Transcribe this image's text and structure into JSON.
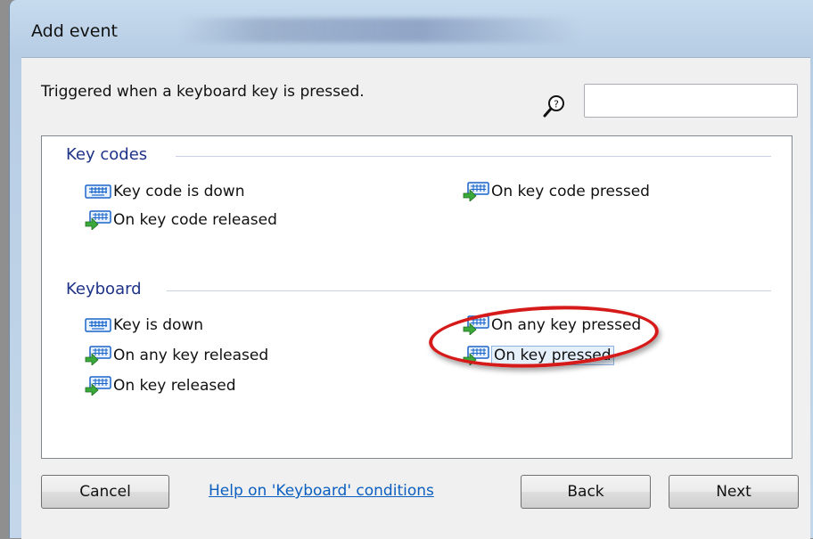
{
  "window": {
    "title": "Add event"
  },
  "description": "Triggered when a keyboard key is pressed.",
  "search": {
    "value": "",
    "icon": "search-help-icon"
  },
  "groups": {
    "key_codes": {
      "header": "Key codes",
      "items": [
        {
          "label": "Key code is down",
          "icon": "keyboard-icon"
        },
        {
          "label": "On key code pressed",
          "icon": "keyboard-arrow-icon"
        },
        {
          "label": "On key code released",
          "icon": "keyboard-arrow-icon"
        }
      ]
    },
    "keyboard": {
      "header": "Keyboard",
      "items": [
        {
          "label": "Key is down",
          "icon": "keyboard-icon"
        },
        {
          "label": "On any key pressed",
          "icon": "keyboard-arrow-icon"
        },
        {
          "label": "On any key released",
          "icon": "keyboard-arrow-icon"
        },
        {
          "label": "On key pressed",
          "icon": "keyboard-arrow-icon",
          "selected": true
        },
        {
          "label": "On key released",
          "icon": "keyboard-arrow-icon"
        }
      ]
    }
  },
  "footer": {
    "cancel_label": "Cancel",
    "help_link": "Help on 'Keyboard' conditions",
    "back_label": "Back",
    "next_label": "Next"
  },
  "colors": {
    "group_header": "#1e3287",
    "link": "#0b5fc0",
    "highlight_ellipse": "#d61a1a"
  }
}
